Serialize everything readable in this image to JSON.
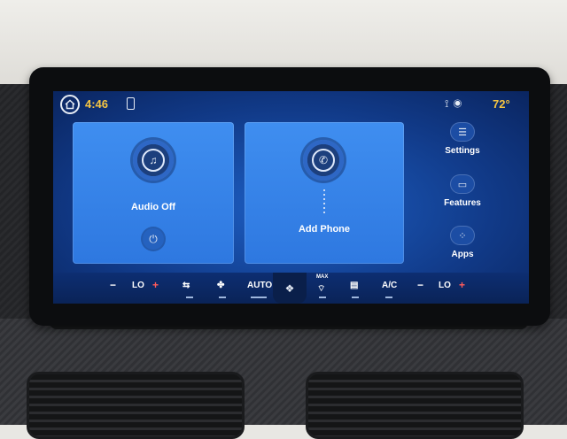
{
  "status": {
    "time": "4:46",
    "temperature": "72°"
  },
  "audio_card": {
    "label": "Audio Off"
  },
  "phone_card": {
    "label": "Add Phone"
  },
  "sidebar": {
    "items": [
      {
        "label": "Settings"
      },
      {
        "label": "Features"
      },
      {
        "label": "Apps"
      }
    ]
  },
  "climate": {
    "left_temp": "LO",
    "right_temp": "LO",
    "minus": "−",
    "plus": "+",
    "auto_label": "AUTO",
    "max_label": "MAX",
    "ac_label": "A/C"
  },
  "colors": {
    "accent": "#f5c542",
    "card": "#3f8ef0",
    "plus_red": "#ff5b5b"
  }
}
